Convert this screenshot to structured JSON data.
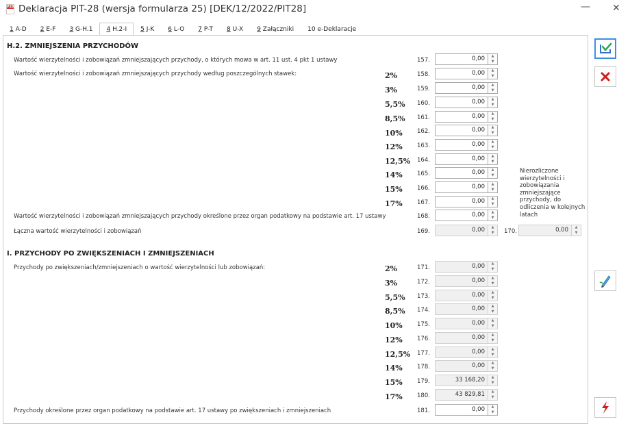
{
  "window": {
    "title": "Deklaracja PIT-28 (wersja formularza 25) [DEK/12/2022/PIT28]",
    "icon_text": "P28",
    "minimize_glyph": "—",
    "close_glyph": "✕"
  },
  "tabs": [
    {
      "num": "1",
      "label": " A-D"
    },
    {
      "num": "2",
      "label": " E-F"
    },
    {
      "num": "3",
      "label": " G-H.1"
    },
    {
      "num": "4",
      "label": " H.2-I"
    },
    {
      "num": "5",
      "label": " J-K"
    },
    {
      "num": "6",
      "label": " L-O"
    },
    {
      "num": "7",
      "label": " P-T"
    },
    {
      "num": "8",
      "label": " U-X"
    },
    {
      "num": "9",
      "label": " Załączniki"
    },
    {
      "num": "",
      "label": "10 e-Deklaracje"
    }
  ],
  "h2": {
    "title": "H.2. ZMNIEJSZENIA PRZYCHODÓW",
    "line157": "Wartość wierzytelności i zobowiązań zmniejszających przychody, o których mowa w art. 11 ust. 4 pkt 1 ustawy",
    "line_rates": "Wartość wierzytelności i zobowiązań zmniejszających przychody według poszczególnych stawek:",
    "line168": "Wartość wierzytelności i zobowiązań zmniejszających przychody określone przez organ podatkowy na podstawie art. 17 ustawy",
    "line169": "Łączna wartość wierzytelności i zobowiązań",
    "note": "Nierozliczone wierzytelności i zobowiązania zmniejszające przychody, do odliczenia w kolejnych latach"
  },
  "i": {
    "title": "I. PRZYCHODY PO ZWIĘKSZENIACH I ZMNIEJSZENIACH",
    "line_rates": "Przychody po zwiększeniach/zmniejszeniach o wartość wierzytelności lub zobowiązań:",
    "line181": "Przychody określone przez organ podatkowy na podstawie art. 17 ustawy po zwiększeniach i zmniejszeniach"
  },
  "rates": [
    "2%",
    "3%",
    "5,5%",
    "8,5%",
    "10%",
    "12%",
    "12,5%",
    "14%",
    "15%",
    "17%"
  ],
  "fields": {
    "f157": {
      "num": "157.",
      "value": "0,00"
    },
    "f158": {
      "num": "158.",
      "value": "0,00"
    },
    "f159": {
      "num": "159.",
      "value": "0,00"
    },
    "f160": {
      "num": "160.",
      "value": "0,00"
    },
    "f161": {
      "num": "161.",
      "value": "0,00"
    },
    "f162": {
      "num": "162.",
      "value": "0,00"
    },
    "f163": {
      "num": "163.",
      "value": "0,00"
    },
    "f164": {
      "num": "164.",
      "value": "0,00"
    },
    "f165": {
      "num": "165.",
      "value": "0,00"
    },
    "f166": {
      "num": "166.",
      "value": "0,00"
    },
    "f167": {
      "num": "167.",
      "value": "0,00"
    },
    "f168": {
      "num": "168.",
      "value": "0,00"
    },
    "f169": {
      "num": "169.",
      "value": "0,00"
    },
    "f170": {
      "num": "170.",
      "value": "0,00"
    },
    "f171": {
      "num": "171.",
      "value": "0,00"
    },
    "f172": {
      "num": "172.",
      "value": "0,00"
    },
    "f173": {
      "num": "173.",
      "value": "0,00"
    },
    "f174": {
      "num": "174.",
      "value": "0,00"
    },
    "f175": {
      "num": "175.",
      "value": "0,00"
    },
    "f176": {
      "num": "176.",
      "value": "0,00"
    },
    "f177": {
      "num": "177.",
      "value": "0,00"
    },
    "f178": {
      "num": "178.",
      "value": "0,00"
    },
    "f179": {
      "num": "179.",
      "value": "33 168,20"
    },
    "f180": {
      "num": "180.",
      "value": "43 829,81"
    },
    "f181": {
      "num": "181.",
      "value": "0,00"
    }
  },
  "spin": {
    "up": "▲",
    "down": "▼"
  },
  "colors": {
    "accent": "#3a8ee6",
    "cancel": "#d01c1c"
  }
}
